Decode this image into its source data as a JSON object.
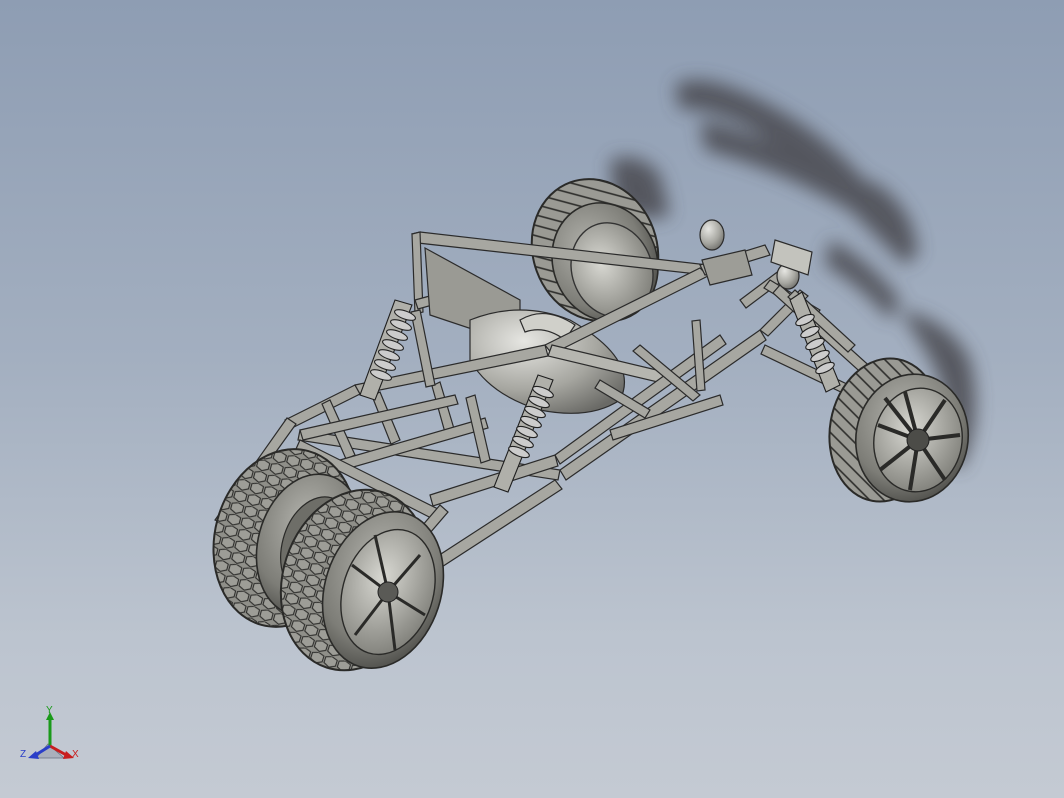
{
  "viewport": {
    "background_top": "#8e9db3",
    "background_bottom": "#c4cad3",
    "model_color": "#8c8c86",
    "edge_color": "#2b2b2b",
    "shadow_color": "#4a4a4f"
  },
  "triad": {
    "x_label": "X",
    "y_label": "Y",
    "z_label": "Z",
    "x_color": "#c81e1e",
    "y_color": "#1a9a1a",
    "z_color": "#2a3ec8"
  }
}
